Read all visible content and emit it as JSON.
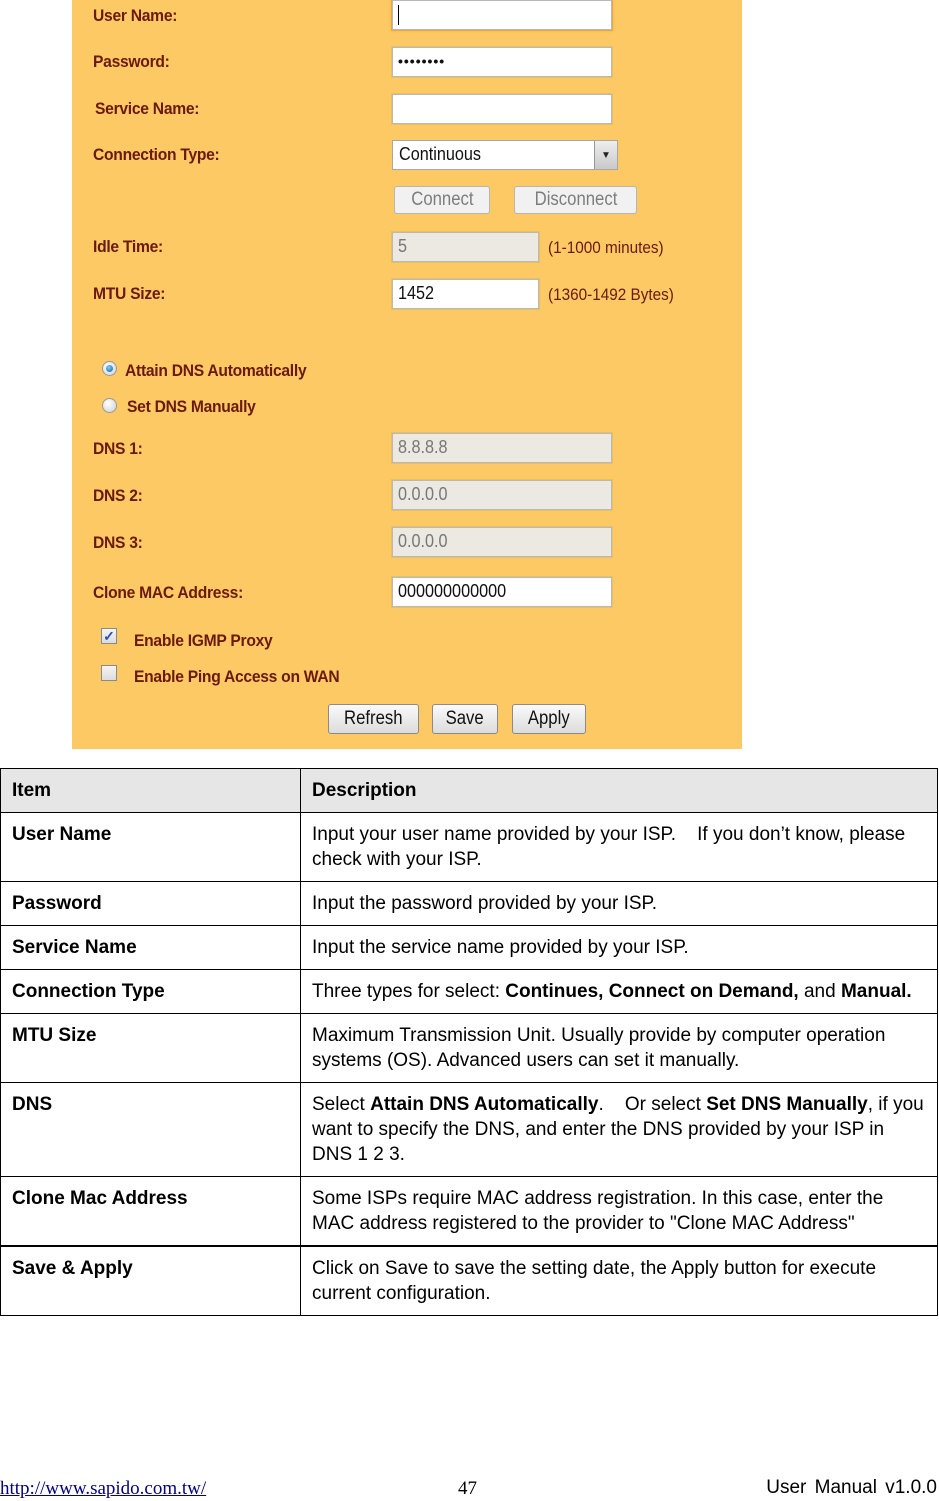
{
  "form": {
    "user_name": {
      "label": "User Name:",
      "value": ""
    },
    "password": {
      "label": "Password:",
      "value": "••••••••"
    },
    "service_name": {
      "label": "Service Name:",
      "value": ""
    },
    "connection_type": {
      "label": "Connection Type:",
      "selected": "Continuous"
    },
    "connect_label": "Connect",
    "disconnect_label": "Disconnect",
    "idle_time": {
      "label": "Idle Time:",
      "value": "5",
      "hint": "(1-1000 minutes)"
    },
    "mtu_size": {
      "label": "MTU Size:",
      "value": "1452",
      "hint": "(1360-1492 Bytes)"
    },
    "dns_mode": {
      "auto_label": "Attain DNS Automatically",
      "manual_label": "Set DNS Manually",
      "selected": "auto"
    },
    "dns1": {
      "label": "DNS 1:",
      "value": "8.8.8.8"
    },
    "dns2": {
      "label": "DNS 2:",
      "value": "0.0.0.0"
    },
    "dns3": {
      "label": "DNS 3:",
      "value": "0.0.0.0"
    },
    "clone_mac": {
      "label": "Clone MAC Address:",
      "value": "000000000000"
    },
    "igmp_proxy": {
      "label": "Enable IGMP Proxy",
      "checked": true
    },
    "ping_wan": {
      "label": "Enable Ping Access on WAN",
      "checked": false
    },
    "refresh_label": "Refresh",
    "save_label": "Save",
    "apply_label": "Apply"
  },
  "table": {
    "headers": [
      "Item",
      "Description"
    ],
    "rows": [
      {
        "item": "User Name",
        "desc": [
          {
            "t": "Input your user name provided by your ISP.    If you don’t know, please check with your ISP."
          }
        ]
      },
      {
        "item": "Password",
        "desc": [
          {
            "t": "Input the password provided by your ISP."
          }
        ]
      },
      {
        "item": "Service Name",
        "desc": [
          {
            "t": "Input the service name provided by your ISP."
          }
        ]
      },
      {
        "item": "Connection Type",
        "desc": [
          {
            "t": "Three types for select: "
          },
          {
            "t": "Continues, Connect on Demand,",
            "b": true
          },
          {
            "t": " and "
          },
          {
            "t": "Manual.",
            "b": true
          }
        ]
      },
      {
        "item": "MTU Size",
        "desc": [
          {
            "t": "Maximum Transmission Unit. Usually provide by computer operation systems (OS). Advanced users can set it manually."
          }
        ]
      },
      {
        "item": "DNS",
        "desc": [
          {
            "t": "Select "
          },
          {
            "t": "Attain DNS Automatically",
            "b": true
          },
          {
            "t": ".    Or select "
          },
          {
            "t": "Set DNS Manually",
            "b": true
          },
          {
            "t": ", if you want to specify the DNS, and enter the DNS provided by your ISP in DNS 1 2 3."
          }
        ]
      },
      {
        "item": "Clone Mac Address",
        "desc": [
          {
            "t": "Some ISPs require MAC address registration. In this case, enter the MAC address registered to the provider to \"Clone MAC Address\""
          }
        ]
      },
      {
        "item": "Save & Apply",
        "desc": [
          {
            "t": "Click on Save to save the setting date, the Apply button for execute current configuration."
          }
        ]
      }
    ]
  },
  "footer": {
    "link": "http://www.sapido.com.tw/",
    "page": "47",
    "manual": "User Manual v1.0.0"
  }
}
